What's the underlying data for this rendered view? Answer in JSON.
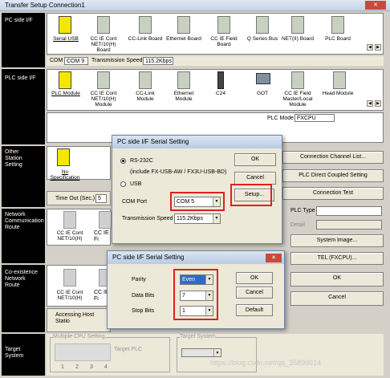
{
  "window": {
    "title": "Transfer Setup Connection1",
    "close_glyph": "✕"
  },
  "pc_side": {
    "label": "PC side I/F",
    "items": [
      "Serial USB",
      "CC IE Cont NET/10(H) Board",
      "CC-Link Board",
      "Ethernet Board",
      "CC IE Field Board",
      "Q Series Bus",
      "NET(II) Board",
      "PLC Board"
    ]
  },
  "com_bar": {
    "com_label": "COM",
    "com_value": "COM 9",
    "speed_label": "Transmission Speed",
    "speed_value": "115.2Kbps"
  },
  "plc_side": {
    "label": "PLC side I/F",
    "items": [
      "PLC Module",
      "CC IE Cont NET/10(H) Module",
      "CC-Link Module",
      "Ethernet Module",
      "C24",
      "GOT",
      "CC IE Field Master/Local Module",
      "Head Module"
    ],
    "plc_mode_label": "PLC Mode",
    "plc_mode_value": "FXCPU"
  },
  "other_station": {
    "label": "Other Station Setting",
    "item": "No Specification",
    "timeout_label": "Time Out (Sec.)",
    "timeout_value": "5"
  },
  "network_route": {
    "label": "Network Communication Route",
    "items": [
      "CC IE Cont NET/10(H)",
      "CC IE Fi"
    ]
  },
  "coexist_route": {
    "label": "Co-existence Network Route",
    "items": [
      "CC IE Cont NET/10(H)",
      "CC IE Fi"
    ],
    "accessing": "Accessing Host Statio"
  },
  "target_system": {
    "label": "Target System",
    "multi_cpu": "Multiple CPU Setting",
    "cpus": [
      "1",
      "2",
      "3",
      "4"
    ],
    "target_plc": "Target PLC",
    "target_sys": "Target System"
  },
  "right_buttons": {
    "channel_list": "Connection Channel List...",
    "direct": "PLC Direct Coupled Setting",
    "test": "Connection Test",
    "plc_type": "PLC Type",
    "detail": "Detail",
    "system_image": "System Image...",
    "tel": "TEL (FXCPU)...",
    "ok": "OK",
    "cancel": "Cancel"
  },
  "dialog1": {
    "title": "PC side I/F Serial Setting",
    "rs232c": "RS-232C",
    "rs232c_note": "(include FX-USB-AW / FX3U-USB-BD)",
    "usb": "USB",
    "com_port_label": "COM Port",
    "com_port_value": "COM 5",
    "speed_label": "Transmission Speed",
    "speed_value": "115.2Kbps",
    "ok": "OK",
    "cancel": "Cancel",
    "setup": "Setup..."
  },
  "dialog2": {
    "title": "PC side I/F Serial Setting",
    "parity_label": "Parity",
    "parity_value": "Even",
    "databits_label": "Data Bits",
    "databits_value": "7",
    "stopbits_label": "Stop Bits",
    "stopbits_value": "1",
    "ok": "OK",
    "cancel": "Cancel",
    "default": "Default",
    "close_glyph": "✕"
  },
  "watermark": "https://blog.csdn.net/qq_35899914",
  "colors": {
    "highlight_red": "#e02020",
    "side_black": "#000000"
  }
}
